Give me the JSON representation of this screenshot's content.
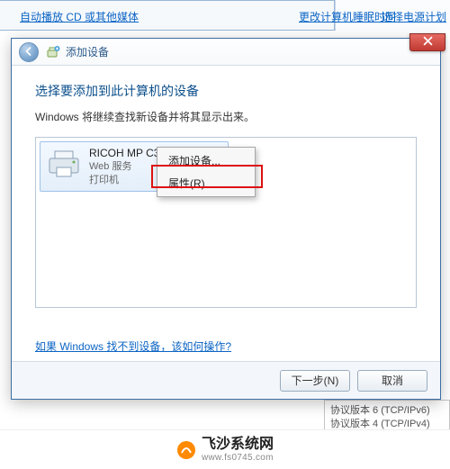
{
  "bg": {
    "autoplay_link": "自动播放 CD 或其他媒体",
    "right_link1": "更改计算机睡眠时间",
    "right_link2": "选择电源计划",
    "right_lower_line1": "协议版本 6 (TCP/IPv6)",
    "right_lower_line2": "协议版本 4 (TCP/IPv4)"
  },
  "dialog": {
    "title": "添加设备",
    "heading": "选择要添加到此计算机的设备",
    "subtext": "Windows 将继续查找新设备并将其显示出来。",
    "device": {
      "name_line": "RICOH MP C3503",
      "sub_line1": "Web 服务",
      "sub_line2": "打印机"
    },
    "context_menu": {
      "item1": "添加设备...",
      "item2": "属性(R)"
    },
    "help_link": "如果 Windows 找不到设备，该如何操作?",
    "footer": {
      "next_label": "下一步(N)",
      "cancel_label": "取消"
    }
  },
  "watermark": {
    "cn": "飞沙系统网",
    "en": "www.fs0745.com"
  },
  "icons": {
    "back": "back-arrow",
    "add_device": "device-plus",
    "close": "close-x",
    "printer": "printer"
  },
  "colors": {
    "link": "#0b64c4",
    "heading": "#0b4f8b",
    "callout": "#d11",
    "close_top": "#e56a63",
    "close_bottom": "#c03a32"
  }
}
